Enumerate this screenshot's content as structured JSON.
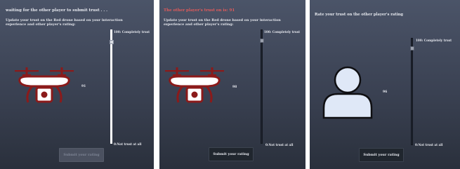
{
  "panel1": {
    "status_text": "waiting for the other player to submit trust . . .",
    "instruction": "Update your trust on the Red drone based on your interaction experience and other player's rating:",
    "slider_top_label": "100: Completely trust",
    "slider_bottom_label": "0:Not trust at all",
    "value_label": "91",
    "slider_value": 91,
    "subject_icon": "red-drone-icon",
    "submit_label": "Submit your rating",
    "submit_enabled": false
  },
  "panel2": {
    "status_text": "The other player's trust on is: 91",
    "instruction": "Update your trust on the Red drone based on your interaction experience and other player's rating:",
    "slider_top_label": "100: Completely trust",
    "slider_bottom_label": "0:Not trust at all",
    "value_label": "98",
    "slider_value": 98,
    "subject_icon": "red-drone-icon",
    "submit_label": "Submit your rating",
    "submit_enabled": true
  },
  "panel3": {
    "prompt": "Rate your trust on the other player's rating",
    "slider_top_label": "100: Completely trust",
    "slider_bottom_label": "0:Not trust at all",
    "value_label": "96",
    "slider_value": 96,
    "subject_icon": "person-avatar-icon",
    "submit_label": "Submit your rating",
    "submit_enabled": true
  },
  "colors": {
    "drone_red": "#8b1a1a",
    "alert_red": "#e25b5b",
    "avatar_fill": "#dfe8f7"
  }
}
